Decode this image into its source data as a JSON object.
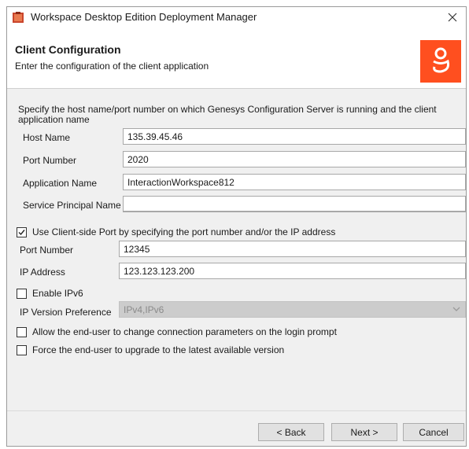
{
  "window": {
    "title": "Workspace Desktop Edition Deployment Manager"
  },
  "header": {
    "title": "Client Configuration",
    "subtitle": "Enter the configuration of the client application",
    "logo_icon": "genesys-logo-icon",
    "logo_color": "#ff4f1f"
  },
  "description": "Specify the host name/port number on which Genesys Configuration Server is running and the client application name",
  "server": {
    "host_label": "Host Name",
    "host_value": "135.39.45.46",
    "port_label": "Port Number",
    "port_value": "2020",
    "app_label": "Application Name",
    "app_value": "InteractionWorkspace812",
    "spn_label": "Service Principal Name",
    "spn_value": ""
  },
  "client_port": {
    "checkbox_label": "Use Client-side Port by specifying the port number and/or the IP address",
    "checked": true,
    "port_label": "Port Number",
    "port_value": "12345",
    "ip_label": "IP Address",
    "ip_value": "123.123.123.200"
  },
  "ipv6": {
    "checkbox_label": "Enable IPv6",
    "checked": false,
    "pref_label": "IP Version Preference",
    "pref_value": "IPv4,IPv6"
  },
  "options": {
    "allow_change_label": "Allow the end-user to change connection parameters on the login prompt",
    "force_upgrade_label": "Force the end-user to upgrade to the latest available version"
  },
  "buttons": {
    "back": "< Back",
    "next": "Next >",
    "cancel": "Cancel"
  }
}
